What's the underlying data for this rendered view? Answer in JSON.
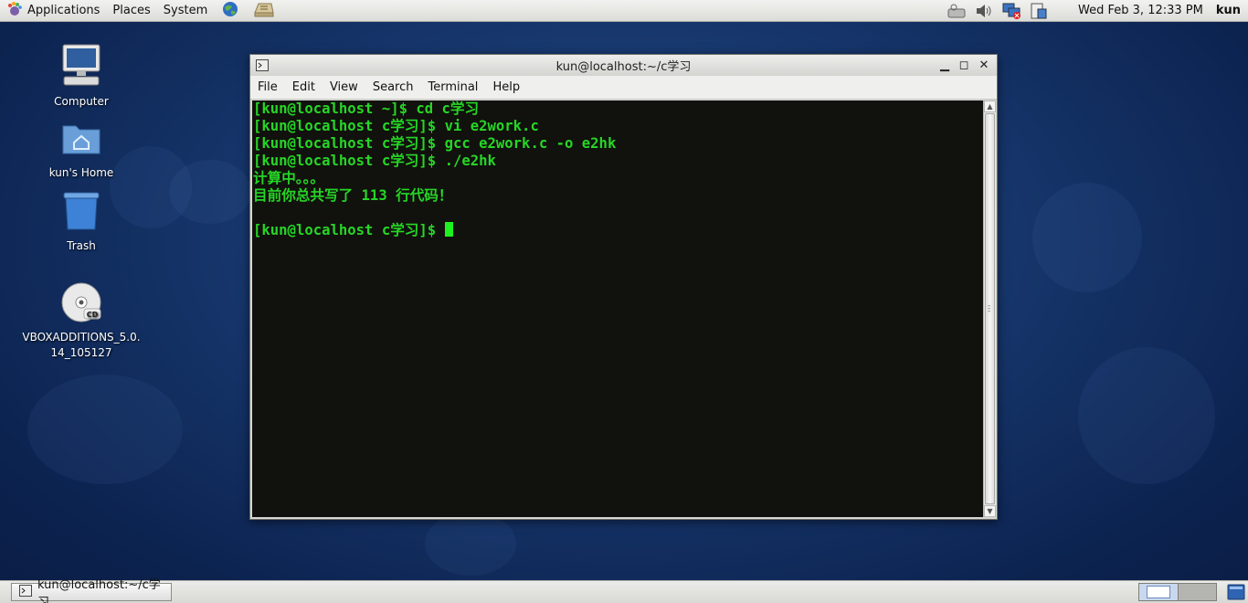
{
  "top_panel": {
    "menus": [
      {
        "name": "applications-menu",
        "label": "Applications",
        "icon": "gnome-foot-icon"
      },
      {
        "name": "places-menu",
        "label": "Places"
      },
      {
        "name": "system-menu",
        "label": "System"
      }
    ],
    "launchers": [
      "web-browser-icon",
      "mail-client-icon"
    ],
    "tray": [
      "network-hardware-icon",
      "volume-icon",
      "network-disconnected-icon",
      "update-notifier-icon"
    ],
    "clock": "Wed Feb  3, 12:33 PM",
    "user": "kun"
  },
  "desktop_icons": [
    {
      "name": "computer",
      "label": "Computer",
      "icon": "computer-icon"
    },
    {
      "name": "home",
      "label": "kun's Home",
      "icon": "home-folder-icon"
    },
    {
      "name": "trash",
      "label": "Trash",
      "icon": "trash-icon"
    },
    {
      "name": "vbox-cd",
      "label_line1": "VBOXADDITIONS_5.0.",
      "label_line2": "14_105127",
      "icon": "cd-icon"
    }
  ],
  "terminal": {
    "title": "kun@localhost:~/c学习",
    "menu": [
      "File",
      "Edit",
      "View",
      "Search",
      "Terminal",
      "Help"
    ],
    "lines": [
      "[kun@localhost ~]$ cd c学习",
      "[kun@localhost c学习]$ vi e2work.c",
      "[kun@localhost c学习]$ gcc e2work.c -o e2hk",
      "[kun@localhost c学习]$ ./e2hk",
      "计算中。。。",
      "目前你总共写了 113 行代码！",
      "",
      "[kun@localhost c学习]$ "
    ],
    "colors": {
      "background": "#11110d",
      "foreground": "#26d626",
      "cursor": "#1ef21e"
    }
  },
  "bottom_panel": {
    "task_label": "kun@localhost:~/c学习",
    "workspaces": [
      "workspace-1",
      "workspace-2"
    ]
  }
}
